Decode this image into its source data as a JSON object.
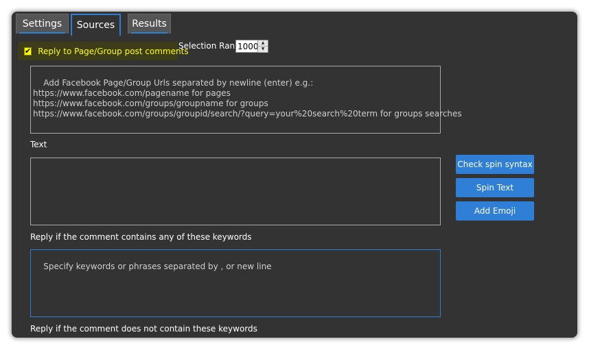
{
  "tabs": [
    {
      "label": "Settings"
    },
    {
      "label": "Sources"
    },
    {
      "label": "Results"
    }
  ],
  "reply_checkbox": {
    "label": "Reply to Page/Group post comments",
    "checked": true
  },
  "selection_rank": {
    "label": "Selection Rank",
    "value": "1000"
  },
  "urls_box": {
    "placeholder": "Add Facebook Page/Group Urls separated by newline (enter) e.g.:\nhttps://www.facebook.com/pagename for pages\nhttps://www.facebook.com/groups/groupname for groups\nhttps://www.facebook.com/groups/groupid/search/?query=your%20search%20term for groups searches"
  },
  "text_section": {
    "label": "Text",
    "value": ""
  },
  "buttons": {
    "check_spin": "Check spin syntax",
    "spin_text": "Spin Text",
    "add_emoji": "Add Emoji"
  },
  "include_keywords": {
    "label": "Reply if the comment contains any of these keywords",
    "placeholder": "Specify keywords or phrases separated by , or new line"
  },
  "exclude_keywords": {
    "label": "Reply if the comment does not contain these keywords"
  },
  "colors": {
    "accent": "#2f7fd6",
    "background": "#333333",
    "highlight": "#ffff00"
  }
}
